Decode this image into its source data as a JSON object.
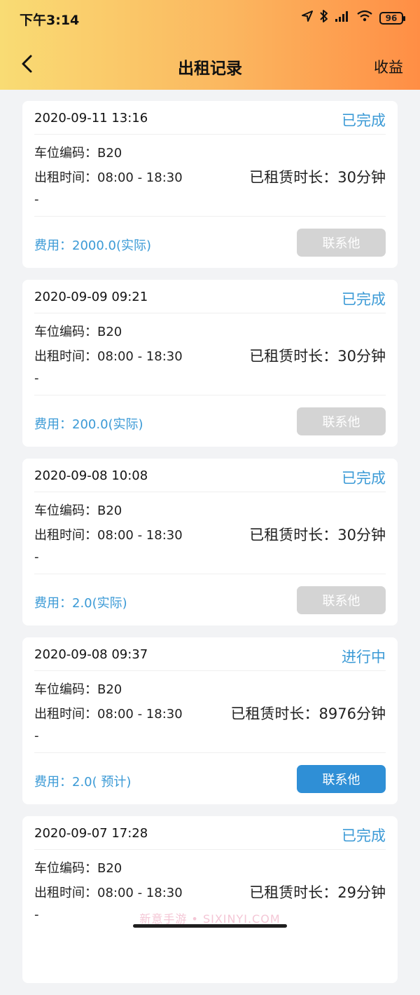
{
  "status_bar": {
    "time": "下午3:14",
    "battery": "96",
    "icons": [
      "location-icon",
      "bluetooth-icon",
      "signal-icon",
      "wifi-icon",
      "battery-icon"
    ]
  },
  "nav": {
    "back_icon": "chevron-left-icon",
    "title": "出租记录",
    "action": "收益"
  },
  "colors": {
    "header_gradient_start": "#f9dc74",
    "header_gradient_end": "#ff8e45",
    "accent": "#3b9ad6",
    "button_active": "#2f8fd6",
    "button_disabled": "#d4d4d4"
  },
  "records": [
    {
      "datetime": "2020-09-11 13:16",
      "status": "已完成",
      "space": "车位编码：B20",
      "period": "出租时间：08:00 - 18:30",
      "dash": "-",
      "duration": "已租赁时长：30分钟",
      "fee": "费用：2000.0(实际)",
      "contact_label": "联系他",
      "contact_active": false
    },
    {
      "datetime": "2020-09-09 09:21",
      "status": "已完成",
      "space": "车位编码：B20",
      "period": "出租时间：08:00 - 18:30",
      "dash": "-",
      "duration": "已租赁时长：30分钟",
      "fee": "费用：200.0(实际)",
      "contact_label": "联系他",
      "contact_active": false
    },
    {
      "datetime": "2020-09-08 10:08",
      "status": "已完成",
      "space": "车位编码：B20",
      "period": "出租时间：08:00 - 18:30",
      "dash": "-",
      "duration": "已租赁时长：30分钟",
      "fee": "费用：2.0(实际)",
      "contact_label": "联系他",
      "contact_active": false
    },
    {
      "datetime": "2020-09-08 09:37",
      "status": "进行中",
      "space": "车位编码：B20",
      "period": "出租时间：08:00 - 18:30",
      "dash": "-",
      "duration": "已租赁时长：8976分钟",
      "fee": "费用：2.0( 预计)",
      "contact_label": "联系他",
      "contact_active": true
    },
    {
      "datetime": "2020-09-07 17:28",
      "status": "已完成",
      "space": "车位编码：B20",
      "period": "出租时间：08:00 - 18:30",
      "dash": "-",
      "duration": "已租赁时长：29分钟",
      "fee": "",
      "contact_label": "",
      "contact_active": false
    }
  ],
  "watermark": "新意手游 • SIXINYI.COM"
}
